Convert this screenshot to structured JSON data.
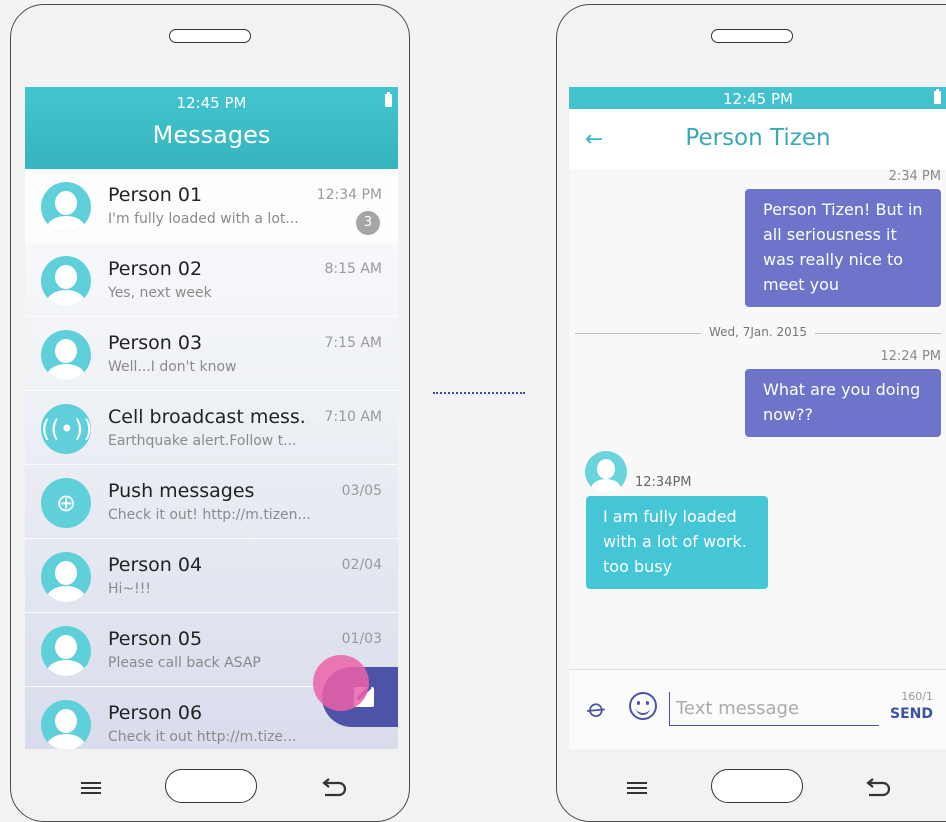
{
  "left": {
    "status_time": "12:45 PM",
    "title": "Messages",
    "items": [
      {
        "name": "Person 01",
        "preview": "I'm fully loaded with a lot...",
        "time": "12:34 PM",
        "badge": "3",
        "icon": "person-icon"
      },
      {
        "name": "Person 02",
        "preview": "Yes, next week",
        "time": "8:15 AM",
        "icon": "person-icon"
      },
      {
        "name": "Person 03",
        "preview": "Well...I don't know",
        "time": "7:15 AM",
        "icon": "person-icon"
      },
      {
        "name": "Cell broadcast mess...",
        "preview": "Earthquake alert.Follow t...",
        "time": "7:10 AM",
        "icon": "broadcast-icon"
      },
      {
        "name": "Push messages",
        "preview": "Check it out! http://m.tizen...",
        "time": "03/05",
        "icon": "globe-icon"
      },
      {
        "name": "Person 04",
        "preview": "Hi~!!!",
        "time": "02/04",
        "icon": "person-icon"
      },
      {
        "name": "Person 05",
        "preview": "Please call back ASAP",
        "time": "01/03",
        "icon": "person-icon"
      },
      {
        "name": "Person 06",
        "preview": "Check it out http://m.tize...",
        "time": "",
        "icon": "person-icon"
      }
    ]
  },
  "right": {
    "status_time": "12:45 PM",
    "title": "Person Tizen",
    "messages": {
      "out1_time": "2:34 PM",
      "out1_text": "Person Tizen! But in all seriousness it was really nice to meet you",
      "date_separator": "Wed, 7Jan. 2015",
      "out2_time": "12:24 PM",
      "out2_text": "What are you doing now??",
      "in1_time": "12:34PM",
      "in1_text": "I am fully loaded with a lot of work. too busy"
    },
    "composer": {
      "placeholder": "Text message",
      "counter": "160/1",
      "send_label": "SEND"
    }
  },
  "colors": {
    "accent_teal": "#43c5cf",
    "accent_indigo": "#4d54a8",
    "bubble_out": "#6e74c9",
    "bubble_in": "#45c6d6",
    "ripple_pink": "#ec62a8"
  }
}
